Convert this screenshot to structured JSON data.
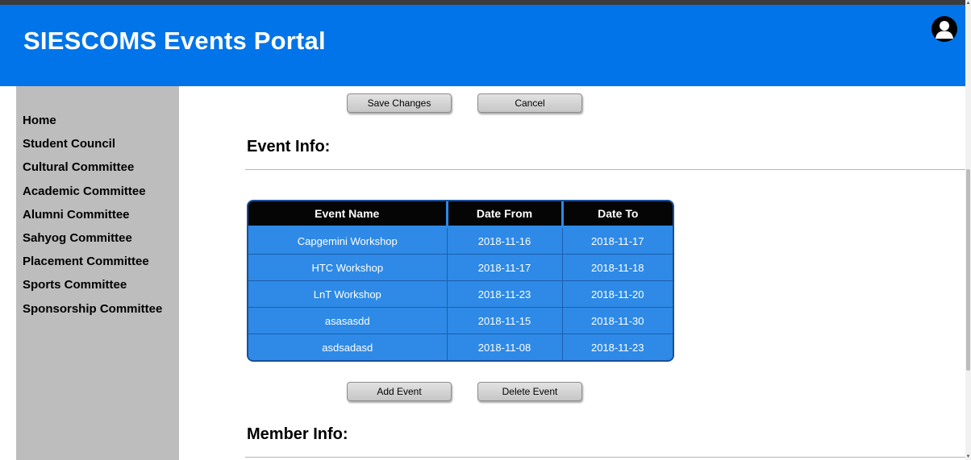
{
  "header": {
    "title": "SIESCOMS Events Portal",
    "avatar_icon": "user-icon",
    "background_color": "#0074e8"
  },
  "sidebar": {
    "items": [
      {
        "label": "Home"
      },
      {
        "label": "Student Council"
      },
      {
        "label": "Cultural Committee"
      },
      {
        "label": "Academic Committee"
      },
      {
        "label": "Alumni Committee"
      },
      {
        "label": "Sahyog Committee"
      },
      {
        "label": "Placement Committee"
      },
      {
        "label": "Sports Committee"
      },
      {
        "label": "Sponsorship Committee"
      }
    ]
  },
  "toolbar": {
    "save_label": "Save Changes",
    "cancel_label": "Cancel"
  },
  "event_section": {
    "title": "Event Info:",
    "columns": [
      "Event Name",
      "Date From",
      "Date To"
    ],
    "rows": [
      [
        "Capgemini Workshop",
        "2018-11-16",
        "2018-11-17"
      ],
      [
        "HTC Workshop",
        "2018-11-17",
        "2018-11-18"
      ],
      [
        "LnT Workshop",
        "2018-11-23",
        "2018-11-20"
      ],
      [
        "asasasdd",
        "2018-11-15",
        "2018-11-30"
      ],
      [
        "asdsadasd",
        "2018-11-08",
        "2018-11-23"
      ]
    ],
    "add_label": "Add Event",
    "delete_label": "Delete Event"
  },
  "member_section": {
    "title": "Member Info:"
  }
}
